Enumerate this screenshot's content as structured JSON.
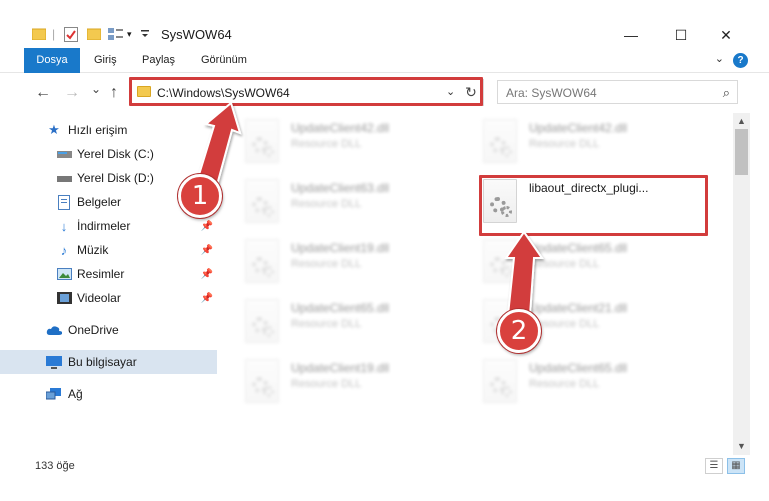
{
  "window": {
    "title": "SysWOW64",
    "minimize_glyph": "—",
    "maximize_glyph": "☐",
    "close_glyph": "✕"
  },
  "ribbon": {
    "tabs": [
      "Dosya",
      "Giriş",
      "Paylaş",
      "Görünüm"
    ],
    "help": "?"
  },
  "navigation": {
    "back": "←",
    "forward": "→",
    "recent": "⌄",
    "up": "↑",
    "address": "C:\\Windows\\SysWOW64",
    "search_placeholder": "Ara: SysWOW64"
  },
  "sidebar": {
    "items": [
      {
        "label": "Hızlı erişim",
        "icon": "star-icon",
        "pinned": false
      },
      {
        "label": "Yerel Disk (C:)",
        "icon": "drive-icon",
        "pinned": false
      },
      {
        "label": "Yerel Disk (D:)",
        "icon": "drive-icon",
        "pinned": false
      },
      {
        "label": "Belgeler",
        "icon": "documents-icon",
        "pinned": true
      },
      {
        "label": "İndirmeler",
        "icon": "download-icon",
        "pinned": true
      },
      {
        "label": "Müzik",
        "icon": "music-icon",
        "pinned": true
      },
      {
        "label": "Resimler",
        "icon": "pictures-icon",
        "pinned": true
      },
      {
        "label": "Videolar",
        "icon": "video-icon",
        "pinned": true
      },
      {
        "label": "OneDrive",
        "icon": "cloud-icon",
        "pinned": false
      },
      {
        "label": "Bu bilgisayar",
        "icon": "computer-icon",
        "pinned": false
      },
      {
        "label": "Ağ",
        "icon": "network-icon",
        "pinned": false
      }
    ]
  },
  "files": [
    {
      "name": "UpdateClient42.dll",
      "type": "Resource DLL"
    },
    {
      "name": "UpdateClient42.dll",
      "type": "Resource DLL"
    },
    {
      "name": "UpdateClient63.dll",
      "type": "Resource DLL"
    },
    {
      "name": "libaout_directx_plugi...",
      "type": ""
    },
    {
      "name": "UpdateClient19.dll",
      "type": "Resource DLL"
    },
    {
      "name": "UpdateClient65.dll",
      "type": "Resource DLL"
    },
    {
      "name": "UpdateClient65.dll",
      "type": "Resource DLL"
    },
    {
      "name": "UpdateClient21.dll",
      "type": "Resource DLL"
    },
    {
      "name": "UpdateClient19.dll",
      "type": "Resource DLL"
    },
    {
      "name": "UpdateClient65.dll",
      "type": "Resource DLL"
    }
  ],
  "status": {
    "count": "133 öğe"
  },
  "annotations": {
    "step1": "1",
    "step2": "2",
    "accent_color": "#d23c3c"
  }
}
